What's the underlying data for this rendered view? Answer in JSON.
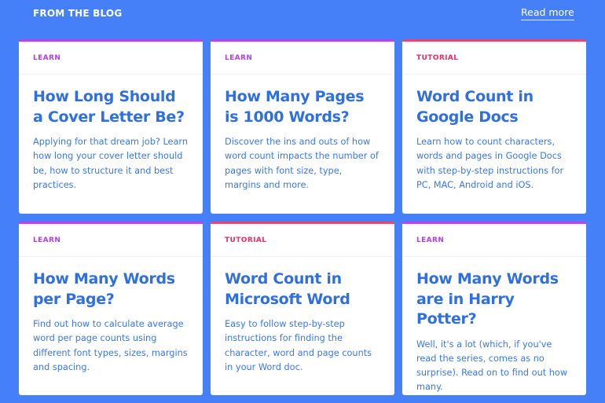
{
  "header": {
    "title": "FROM THE BLOG",
    "read_more": "Read more"
  },
  "colors": {
    "background": "#4580f8",
    "learn_accent": "#c53cf0",
    "tutorial_accent": "#f5416d",
    "title_text": "#2f6fe0"
  },
  "cards": [
    {
      "category": "LEARN",
      "title": "How Long Should a Cover Letter Be?",
      "description": "Applying for that dream job? Learn how long your cover letter should be, how to structure it and best practices."
    },
    {
      "category": "LEARN",
      "title": "How Many Pages is 1000 Words?",
      "description": "Discover the ins and outs of how word count impacts the number of pages with font size, type, margins and more."
    },
    {
      "category": "TUTORIAL",
      "title": "Word Count in Google Docs",
      "description": "Learn how to count characters, words and pages in Google Docs with step-by-step instructions for PC, MAC, Android and iOS."
    },
    {
      "category": "LEARN",
      "title": "How Many Words per Page?",
      "description": "Find out how to calculate average word per page counts using different font types, sizes, margins and spacing."
    },
    {
      "category": "TUTORIAL",
      "title": "Word Count in Microsoft Word",
      "description": "Easy to follow step-by-step instructions for finding the character, word and page counts in your Word doc."
    },
    {
      "category": "LEARN",
      "title": "How Many Words are in Harry Potter?",
      "description": "Well, it's a lot (which, if you've read the series, comes as no surprise). Read on to find out how many."
    }
  ]
}
